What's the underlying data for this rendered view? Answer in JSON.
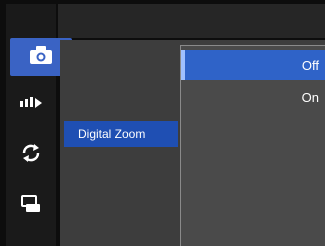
{
  "rail": {
    "items": [
      {
        "icon": "camera-icon",
        "active": true
      },
      {
        "icon": "face-detect-icon",
        "active": false
      },
      {
        "icon": "rotate-icon",
        "active": false
      },
      {
        "icon": "settings-icon",
        "active": false
      }
    ]
  },
  "menu": {
    "current_option": "Digital Zoom"
  },
  "dropdown": {
    "options": [
      "Off",
      "On"
    ],
    "selected": "Off"
  },
  "colors": {
    "accent": "#2f63c8",
    "option_highlight": "#1f4fb3",
    "panel": "#3d3d3d",
    "dropdown": "#4a4a4a"
  }
}
